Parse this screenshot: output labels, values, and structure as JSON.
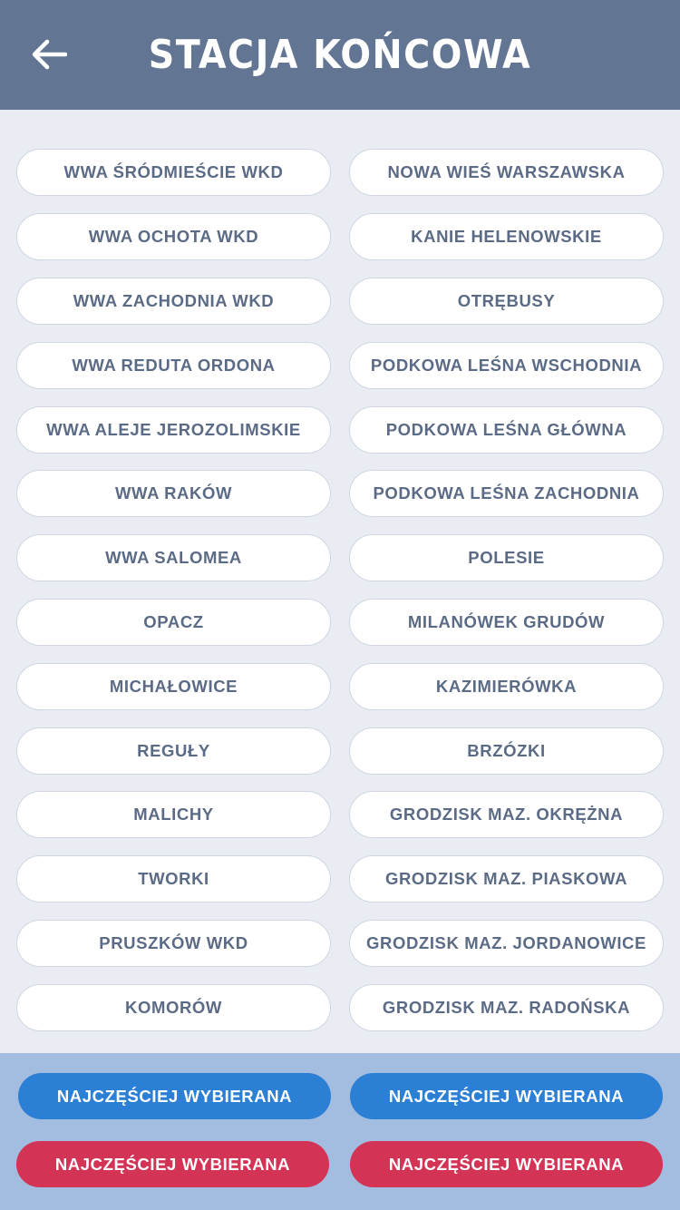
{
  "header": {
    "title": "STACJA KOŃCOWA",
    "back_icon": "arrow-left-icon"
  },
  "stations": {
    "left": [
      "WWA ŚRÓDMIEŚCIE WKD",
      "WWA OCHOTA WKD",
      "WWA ZACHODNIA WKD",
      "WWA REDUTA ORDONA",
      "WWA ALEJE JEROZOLIMSKIE",
      "WWA RAKÓW",
      "WWA SALOMEA",
      "OPACZ",
      "MICHAŁOWICE",
      "REGUŁY",
      "MALICHY",
      "TWORKI",
      "PRUSZKÓW WKD",
      "KOMORÓW"
    ],
    "right": [
      "NOWA WIEŚ WARSZAWSKA",
      "KANIE HELENOWSKIE",
      "OTRĘBUSY",
      "PODKOWA LEŚNA WSCHODNIA",
      "PODKOWA LEŚNA GŁÓWNA",
      "PODKOWA LEŚNA ZACHODNIA",
      "POLESIE",
      "MILANÓWEK GRUDÓW",
      "KAZIMIERÓWKA",
      "BRZÓZKI",
      "GRODZISK MAZ. OKRĘŻNA",
      "GRODZISK MAZ. PIASKOWA",
      "GRODZISK MAZ. JORDANOWICE",
      "GRODZISK MAZ. RADOŃSKA"
    ]
  },
  "footer": {
    "blue_left": "NAJCZĘŚCIEJ WYBIERANA",
    "blue_right": "NAJCZĘŚCIEJ WYBIERANA",
    "red_left": "NAJCZĘŚCIEJ WYBIERANA",
    "red_right": "NAJCZĘŚCIEJ WYBIERANA"
  },
  "colors": {
    "header_bg": "#627694",
    "body_bg": "#e9edf3",
    "station_text": "#5b6b86",
    "footer_bg": "#a3bde0",
    "blue": "#2b7fd4",
    "red": "#d33355"
  }
}
